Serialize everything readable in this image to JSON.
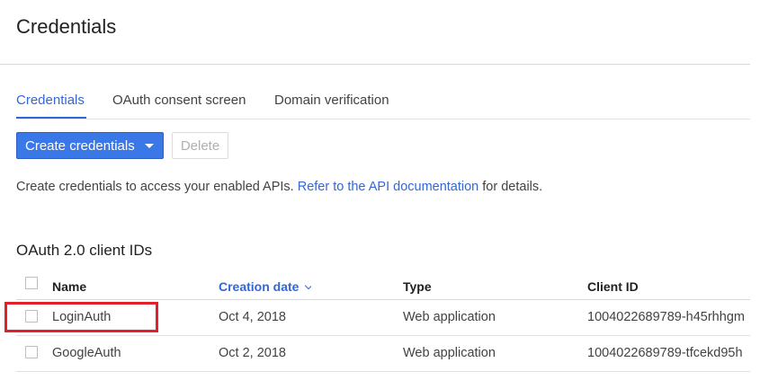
{
  "header": {
    "title": "Credentials"
  },
  "tabs": [
    {
      "label": "Credentials",
      "active": true
    },
    {
      "label": "OAuth consent screen",
      "active": false
    },
    {
      "label": "Domain verification",
      "active": false
    }
  ],
  "toolbar": {
    "create_label": "Create credentials",
    "delete_label": "Delete"
  },
  "info": {
    "text": "Create credentials to access your enabled APIs.",
    "link": "Refer to the API documentation",
    "suffix": "for details."
  },
  "section": {
    "title": "OAuth 2.0 client IDs"
  },
  "table": {
    "columns": [
      "Name",
      "Creation date",
      "Type",
      "Client ID"
    ],
    "rows": [
      {
        "name": "LoginAuth",
        "date": "Oct 4, 2018",
        "type": "Web application",
        "client_id": "1004022689789-h45rhhgm"
      },
      {
        "name": "GoogleAuth",
        "date": "Oct 2, 2018",
        "type": "Web application",
        "client_id": "1004022689789-tfcekd95h"
      }
    ]
  },
  "colors": {
    "accent": "#3367d6",
    "primary_button": "#3b78e7",
    "highlight": "#e0202a"
  }
}
